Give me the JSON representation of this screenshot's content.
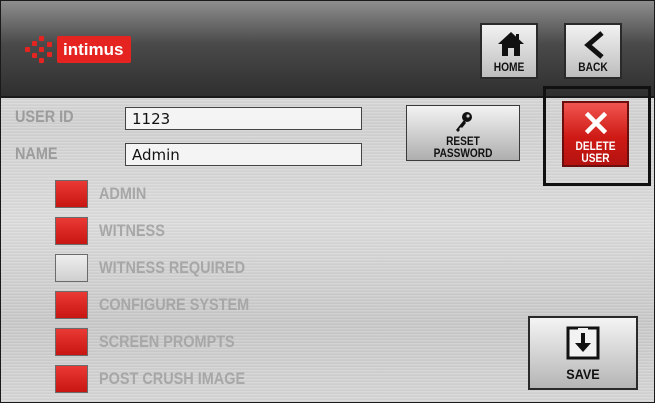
{
  "brand": {
    "logo_text": "intimus",
    "accent": "#e52421"
  },
  "header": {
    "home_label": "HOME",
    "back_label": "BACK",
    "home_icon": "home-icon",
    "back_icon": "chevron-left-icon"
  },
  "user": {
    "user_id_label": "USER ID",
    "user_id_value": "1123",
    "name_label": "NAME",
    "name_value": "Admin"
  },
  "permissions": [
    {
      "label": "ADMIN",
      "enabled": true
    },
    {
      "label": "WITNESS",
      "enabled": true
    },
    {
      "label": "WITNESS REQUIRED",
      "enabled": false
    },
    {
      "label": "CONFIGURE SYSTEM",
      "enabled": true
    },
    {
      "label": "SCREEN PROMPTS",
      "enabled": true
    },
    {
      "label": "POST CRUSH IMAGE",
      "enabled": true
    }
  ],
  "actions": {
    "reset_line1": "RESET",
    "reset_line2": "PASSWORD",
    "reset_icon": "key-icon",
    "delete_line1": "DELETE",
    "delete_line2": "USER",
    "delete_icon": "close-icon",
    "save_label": "SAVE",
    "save_icon": "save-icon"
  },
  "colors": {
    "enabled": "#d41f1b",
    "disabled": "#e0e0e0",
    "label": "#a7a7a7"
  }
}
